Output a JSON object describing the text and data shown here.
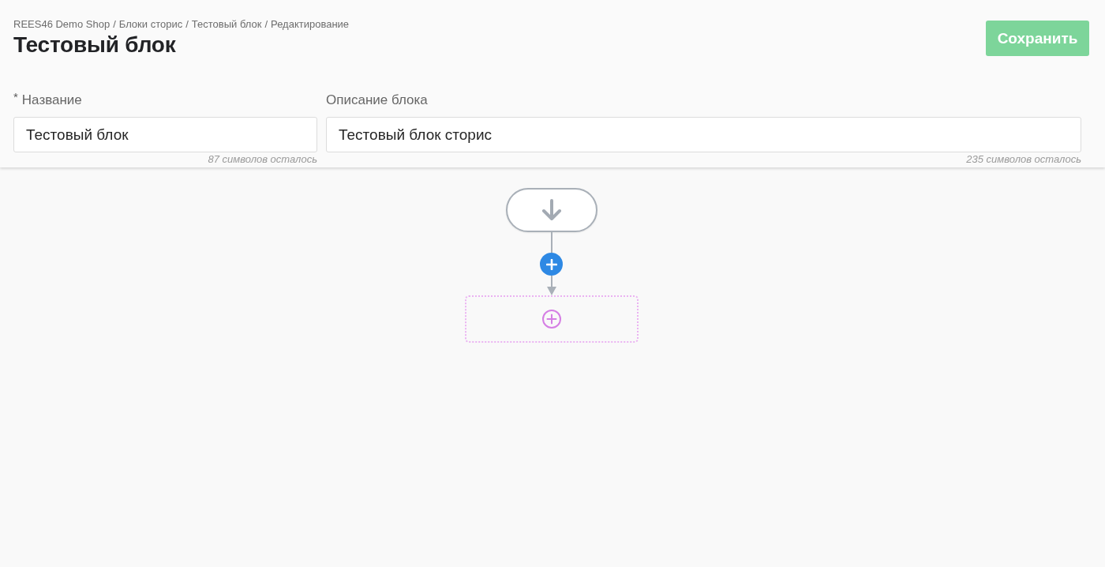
{
  "breadcrumb": {
    "separator": "/",
    "items": [
      "REES46 Demo Shop",
      "Блоки сторис",
      "Тестовый блок",
      "Редактирование"
    ]
  },
  "title": "Тестовый блок",
  "save_button": {
    "label": "Сохранить",
    "disabled": true
  },
  "fields": [
    {
      "required_mark": "*",
      "label": "Название",
      "value": "Тестовый блок",
      "counter": "87 символов осталось"
    },
    {
      "label": "Описание блока",
      "value": "Тестовый блок сторис",
      "counter": "235 символов осталось"
    }
  ],
  "flow": {
    "nodes": [
      {
        "kind": "start"
      },
      {
        "kind": "add"
      },
      {
        "kind": "placeholder"
      }
    ]
  }
}
